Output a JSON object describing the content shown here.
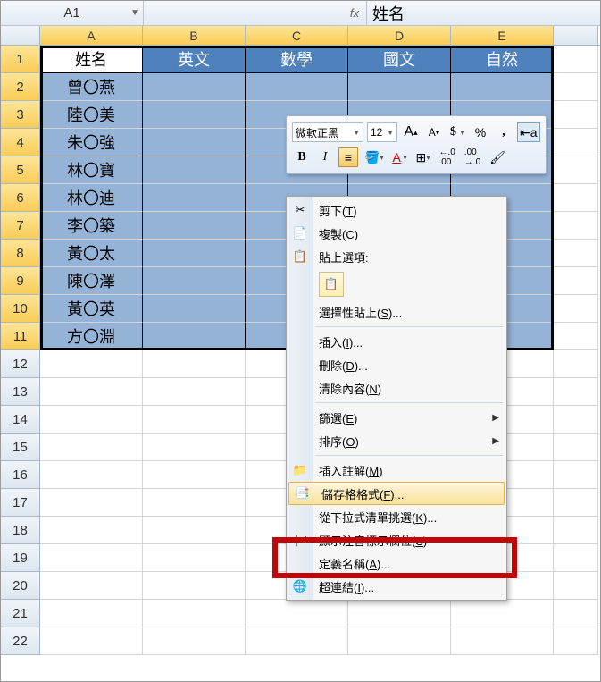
{
  "formula_bar": {
    "name_box": "A1",
    "fx_label": "fx",
    "value": "姓名"
  },
  "columns": [
    "A",
    "B",
    "C",
    "D",
    "E"
  ],
  "selected_columns_count": 5,
  "rows_visible": 22,
  "selected_rows_count": 11,
  "headers": [
    "姓名",
    "英文",
    "數學",
    "國文",
    "自然"
  ],
  "data": [
    "曾〇燕",
    "陸〇美",
    "朱〇強",
    "林〇寶",
    "林〇迪",
    "李〇築",
    "黃〇太",
    "陳〇澤",
    "黃〇英",
    "方〇淵"
  ],
  "mini_toolbar": {
    "font": "微軟正黑",
    "size": "12",
    "grow_font": "A",
    "shrink_font": "A",
    "currency": "$",
    "percent": "%",
    "comma": ",",
    "bold": "B",
    "italic": "I",
    "center": "≡",
    "fill_label": "⬙",
    "font_color": "A",
    "border": "⊞",
    "inc_dec": ".00",
    "dec_dec": ".0",
    "format_painter": "✐"
  },
  "ctx": {
    "cut": "剪下(T)",
    "copy": "複製(C)",
    "paste_options": "貼上選項:",
    "paste_special": "選擇性貼上(S)...",
    "insert": "插入(I)...",
    "delete": "刪除(D)...",
    "clear": "清除內容(N)",
    "filter": "篩選(E)",
    "sort": "排序(O)",
    "comment": "插入註解(M)",
    "format_cells": "儲存格格式(F)...",
    "dropdown": "從下拉式清單挑選(K)...",
    "phonetic": "顯示注音標示欄位(S)",
    "define_name": "定義名稱(A)...",
    "hyperlink": "超連結(I)..."
  }
}
